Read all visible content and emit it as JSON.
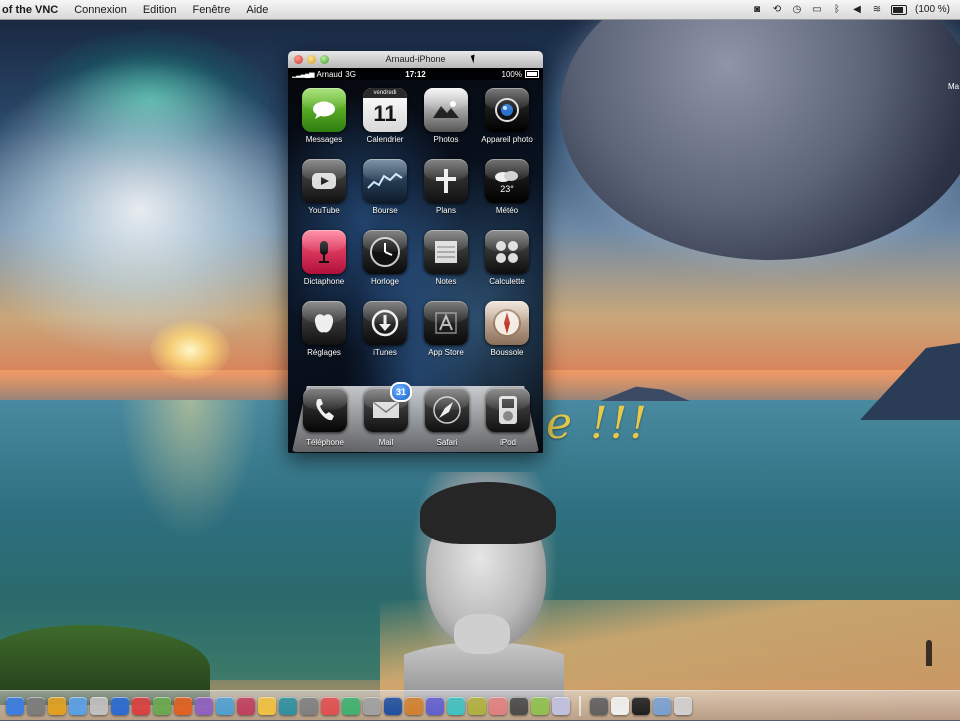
{
  "menubar": {
    "app_name": "of the VNC",
    "menus": [
      "Connexion",
      "Edition",
      "Fenêtre",
      "Aide"
    ],
    "battery_text": "(100 %)"
  },
  "desktop": {
    "overlay_text": "e !!!",
    "edge_label": "Ma"
  },
  "vnc_window": {
    "title": "Arnaud-iPhone"
  },
  "iphone": {
    "status": {
      "carrier": "Arnaud",
      "network": "3G",
      "time": "17:12",
      "battery": "100%"
    },
    "apps": [
      {
        "label": "Messages",
        "icon": "messages-icon"
      },
      {
        "label": "Calendrier",
        "icon": "calendar-icon",
        "weekday": "vendredi",
        "day": "11"
      },
      {
        "label": "Photos",
        "icon": "photos-icon"
      },
      {
        "label": "Appareil photo",
        "icon": "camera-icon"
      },
      {
        "label": "YouTube",
        "icon": "youtube-icon"
      },
      {
        "label": "Bourse",
        "icon": "stocks-icon"
      },
      {
        "label": "Plans",
        "icon": "maps-icon"
      },
      {
        "label": "Météo",
        "icon": "weather-icon",
        "temp": "23°"
      },
      {
        "label": "Dictaphone",
        "icon": "dictaphone-icon"
      },
      {
        "label": "Horloge",
        "icon": "clock-icon"
      },
      {
        "label": "Notes",
        "icon": "notes-icon"
      },
      {
        "label": "Calculette",
        "icon": "calculator-icon"
      },
      {
        "label": "Réglages",
        "icon": "settings-icon"
      },
      {
        "label": "iTunes",
        "icon": "itunes-icon"
      },
      {
        "label": "App Store",
        "icon": "appstore-icon"
      },
      {
        "label": "Boussole",
        "icon": "compass-icon"
      }
    ],
    "dock": [
      {
        "label": "Téléphone",
        "icon": "phone-icon"
      },
      {
        "label": "Mail",
        "icon": "mail-icon",
        "badge": "31"
      },
      {
        "label": "Safari",
        "icon": "safari-icon"
      },
      {
        "label": "iPod",
        "icon": "ipod-icon"
      }
    ]
  },
  "mac_dock": {
    "colors": [
      "#3b7de0",
      "#7c7c7c",
      "#e0a020",
      "#5aa0e6",
      "#c0c0c0",
      "#2a6ad0",
      "#d94040",
      "#6aa84f",
      "#e06020",
      "#9060c0",
      "#50a0d0",
      "#c04060",
      "#f0c040",
      "#3090a0",
      "#808080",
      "#e05050",
      "#40b070",
      "#a0a0a0",
      "#2050a0",
      "#d08030",
      "#6060d0",
      "#40c0c0",
      "#b0b040",
      "#e08080",
      "#4a4a4a",
      "#90c050",
      "#c0c0e0",
      "#606060",
      "#f0f0f0",
      "#202020",
      "#7aa0d0",
      "#d0d0d0"
    ]
  }
}
